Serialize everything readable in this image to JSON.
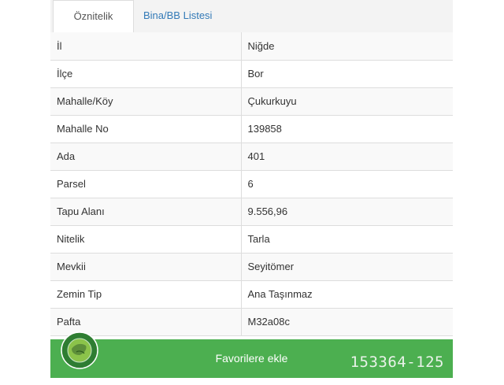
{
  "tabs": [
    {
      "label": "Öznitelik Bilgisi",
      "active": true
    },
    {
      "label": "Bina/BB Listesi",
      "active": false
    }
  ],
  "attributes": [
    {
      "key": "İl",
      "value": "Niğde"
    },
    {
      "key": "İlçe",
      "value": "Bor"
    },
    {
      "key": "Mahalle/Köy",
      "value": "Çukurkuyu"
    },
    {
      "key": "Mahalle No",
      "value": "139858"
    },
    {
      "key": "Ada",
      "value": "401"
    },
    {
      "key": "Parsel",
      "value": "6"
    },
    {
      "key": "Tapu Alanı",
      "value": "9.556,96"
    },
    {
      "key": "Nitelik",
      "value": "Tarla"
    },
    {
      "key": "Mevkii",
      "value": "Seyitömer"
    },
    {
      "key": "Zemin Tip",
      "value": "Ana Taşınmaz"
    },
    {
      "key": "Pafta",
      "value": "M32a08c"
    }
  ],
  "favorites": {
    "button_label": "Favorilere ekle",
    "listing_number": "153364-125"
  },
  "watermark": {
    "text_top": "EMLAK",
    "text_bottom": "DÜNYASI"
  },
  "colors": {
    "accent": "#4caf50",
    "link": "#337ab7",
    "row_stripe": "#f9f9f9",
    "border": "#dddddd"
  }
}
